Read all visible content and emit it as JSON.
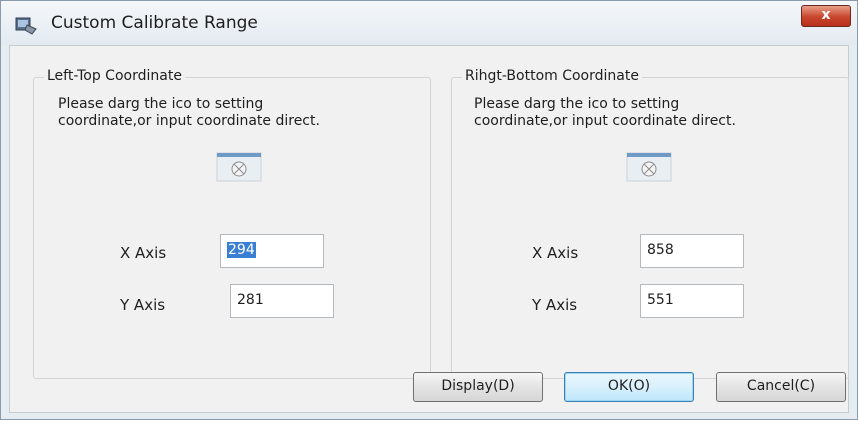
{
  "window": {
    "title": "Custom Calibrate Range",
    "close_label": "x"
  },
  "left_group": {
    "legend": "Left-Top Coordinate",
    "instruction_line1": "Please darg the ico to setting",
    "instruction_line2": "coordinate,or input coordinate direct.",
    "x_label": "X Axis",
    "x_value": "294",
    "y_label": "Y Axis",
    "y_value": "281"
  },
  "right_group": {
    "legend": "Rihgt-Bottom Coordinate",
    "instruction_line1": "Please darg the ico to setting",
    "instruction_line2": "coordinate,or input coordinate direct.",
    "x_label": "X Axis",
    "x_value": "858",
    "y_label": "Y Axis",
    "y_value": "551"
  },
  "buttons": {
    "display": "Display(D)",
    "ok": "OK(O)",
    "cancel": "Cancel(C)"
  },
  "icons": {
    "window_icon": "calibrate-window-icon",
    "drag_handle": "crosshair-drag-icon"
  }
}
